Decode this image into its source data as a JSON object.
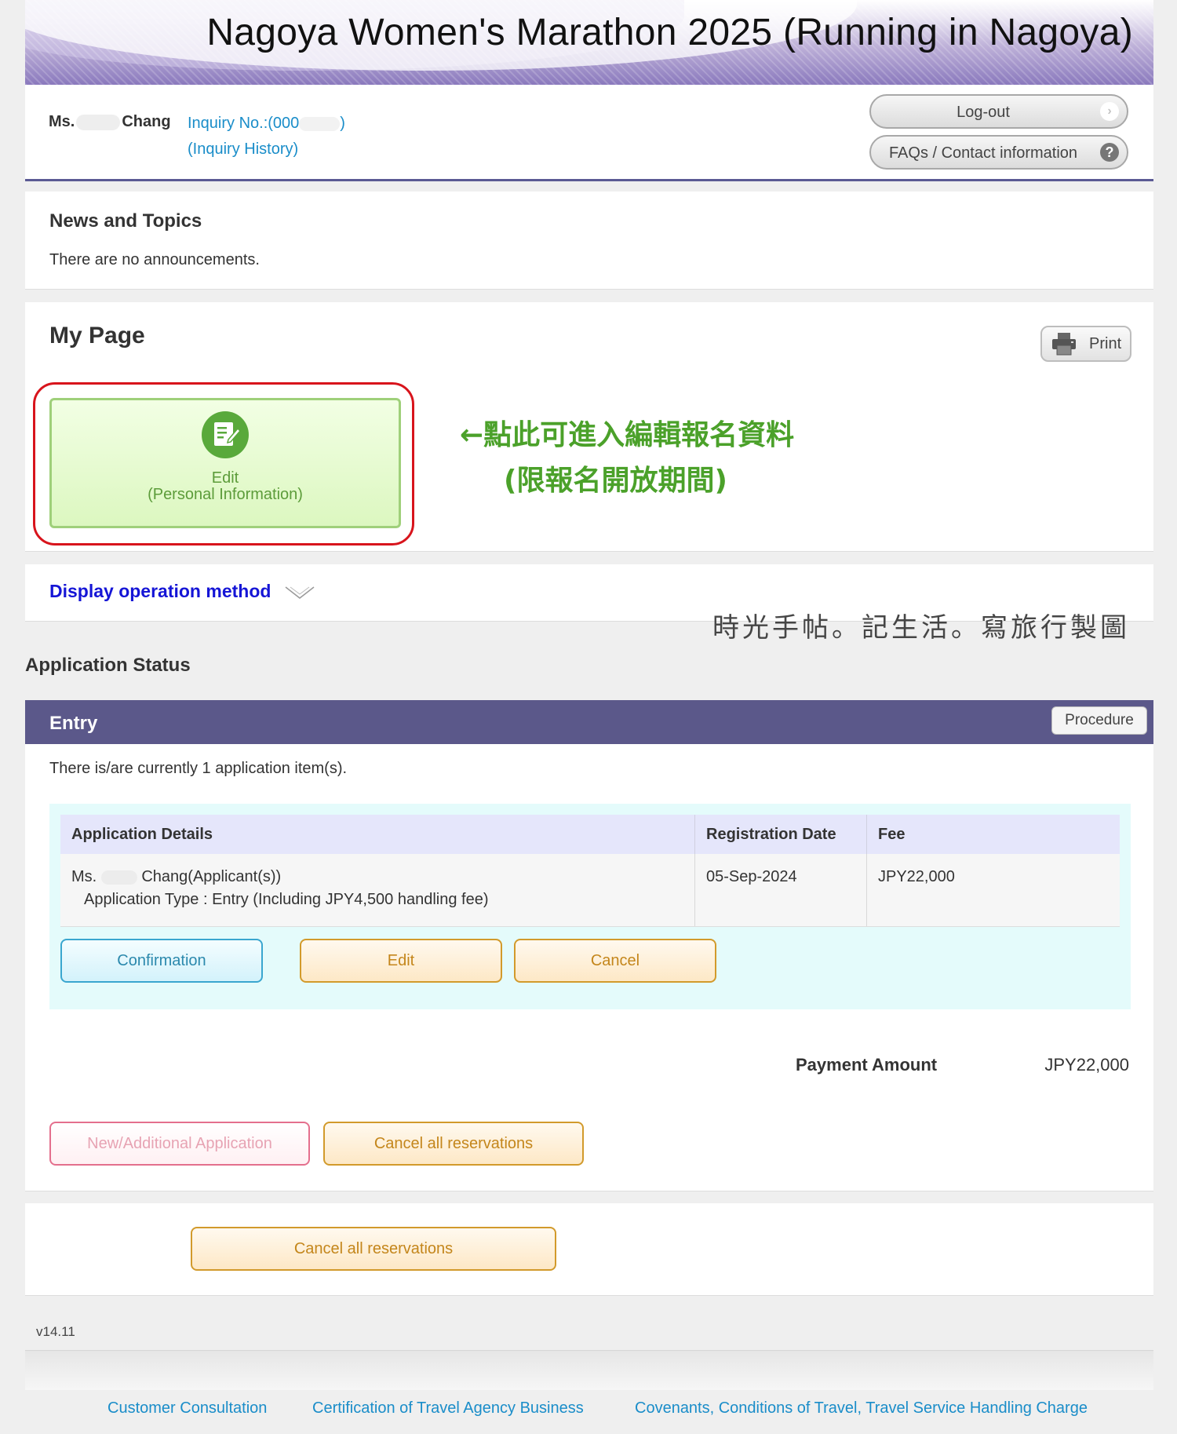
{
  "header": {
    "title": "Nagoya Women's Marathon 2025 (Running in Nagoya)"
  },
  "user": {
    "prefix": "Ms.",
    "surname": "Chang",
    "inquiry_label": "Inquiry No.:(000",
    "inquiry_close": ")",
    "inquiry_history": "(Inquiry History)"
  },
  "top_buttons": {
    "logout": "Log-out",
    "faq": "FAQs / Contact information"
  },
  "news": {
    "title": "News and Topics",
    "text": "There are no announcements."
  },
  "mypage": {
    "title": "My Page",
    "print_label": "Print",
    "edit_line1": "Edit",
    "edit_line2": "(Personal Information)",
    "annotation_line1": "←點此可進入編輯報名資料",
    "annotation_line2": "(限報名開放期間)"
  },
  "operation": {
    "link": "Display operation method"
  },
  "watermark": "時光手帖。記生活。寫旅行製圖",
  "application_status": {
    "title": "Application Status",
    "entry": {
      "title": "Entry",
      "procedure_label": "Procedure",
      "summary": "There is/are currently 1 application item(s).",
      "table": {
        "headers": [
          "Application Details",
          "Registration Date",
          "Fee"
        ],
        "row": {
          "applicant_prefix": "Ms.",
          "applicant_suffix": "Chang(Applicant(s))",
          "type": "Application Type : Entry (Including JPY4,500 handling fee)",
          "date": "05-Sep-2024",
          "fee": "JPY22,000"
        }
      },
      "buttons": {
        "confirmation": "Confirmation",
        "edit": "Edit",
        "cancel": "Cancel"
      },
      "payment_label": "Payment Amount",
      "payment_value": "JPY22,000",
      "new_application": "New/Additional Application",
      "cancel_all": "Cancel all reservations"
    }
  },
  "bottom": {
    "cancel_all": "Cancel all reservations"
  },
  "footer": {
    "version": "v14.11",
    "links": [
      "Customer Consultation",
      "Certification of Travel Agency Business",
      "Covenants, Conditions of Travel, Travel Service Handling Charge"
    ]
  },
  "colors": {
    "header_bar": "#5b588a",
    "link": "#1a8dc9",
    "annotation": "#4ba12a",
    "highlight_border": "#d8141c"
  }
}
